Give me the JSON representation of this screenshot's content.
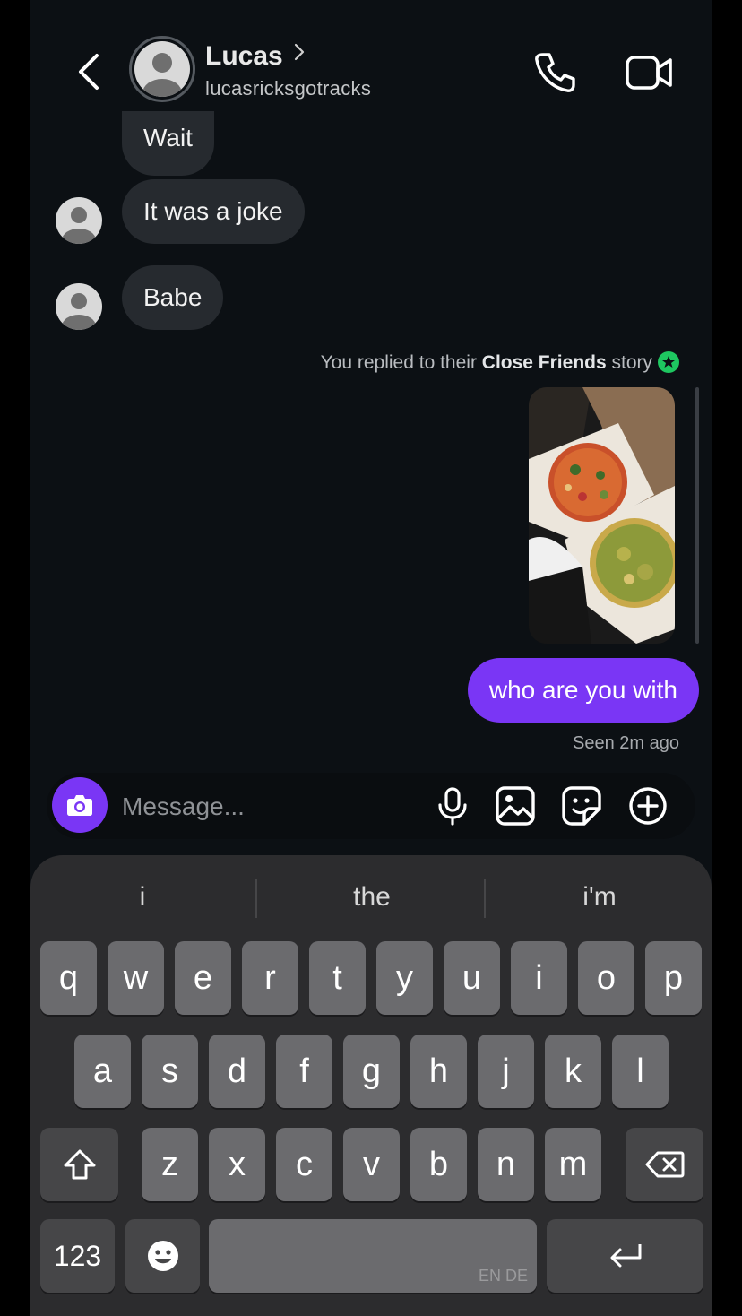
{
  "header": {
    "name": "Lucas",
    "handle": "lucasricksgotracks"
  },
  "messages": {
    "incoming": [
      "Wait",
      "It was a joke",
      "Babe"
    ],
    "reply_note_prefix": "You replied to their ",
    "reply_note_bold": "Close Friends",
    "reply_note_suffix": " story",
    "outgoing": "who are you with",
    "seen": "Seen 2m ago"
  },
  "composer": {
    "placeholder": "Message..."
  },
  "keyboard": {
    "suggestions": [
      "i",
      "the",
      "i'm"
    ],
    "row1": [
      "q",
      "w",
      "e",
      "r",
      "t",
      "y",
      "u",
      "i",
      "o",
      "p"
    ],
    "row2": [
      "a",
      "s",
      "d",
      "f",
      "g",
      "h",
      "j",
      "k",
      "l"
    ],
    "row3": [
      "z",
      "x",
      "c",
      "v",
      "b",
      "n",
      "m"
    ],
    "numbers_label": "123",
    "space_label": "EN DE"
  },
  "colors": {
    "accent": "#7a36f5",
    "close_friends": "#1ec760",
    "bubble_in": "#262a2f",
    "background": "#0c1014"
  }
}
